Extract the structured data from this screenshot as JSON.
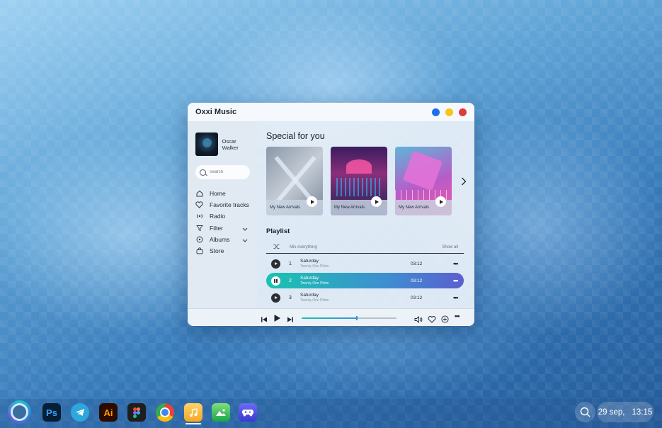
{
  "app": {
    "title": "Oxxi Music",
    "window_dots": [
      "#1f6fe6",
      "#f5c518",
      "#e03b3b"
    ]
  },
  "user": {
    "name": "Oscar Walker"
  },
  "search": {
    "placeholder": "Search",
    "value": ""
  },
  "nav": [
    {
      "label": "Home",
      "icon": "home-icon"
    },
    {
      "label": "Favorite tracks",
      "icon": "heart-icon"
    },
    {
      "label": "Radio",
      "icon": "radio-icon"
    },
    {
      "label": "Filter",
      "icon": "filter-icon",
      "expandable": true
    },
    {
      "label": "Albums",
      "icon": "album-icon",
      "expandable": true
    },
    {
      "label": "Store",
      "icon": "store-icon"
    }
  ],
  "special": {
    "title": "Special for you",
    "cards": [
      {
        "label": "My New Arrivals"
      },
      {
        "label": "My New Arrivals"
      },
      {
        "label": "My New Arrivals"
      }
    ]
  },
  "playlist": {
    "title": "Playlist",
    "mix_label": "Mix everything",
    "show_all": "Show all",
    "tracks": [
      {
        "num": "1",
        "title": "Saturday",
        "artist": "Twenty One Pilots",
        "duration": "03:12",
        "playing": false
      },
      {
        "num": "2",
        "title": "Saturday",
        "artist": "Twenty One Pilots",
        "duration": "03:12",
        "playing": true
      },
      {
        "num": "3",
        "title": "Saturday",
        "artist": "Twenty One Pilots",
        "duration": "03:12",
        "playing": false
      }
    ]
  },
  "player": {
    "progress": 0.58
  },
  "taskbar": {
    "apps": [
      "start-icon",
      "photoshop-icon",
      "telegram-icon",
      "illustrator-icon",
      "figma-icon",
      "chrome-icon",
      "music-icon",
      "gallery-icon",
      "game-icon"
    ],
    "ps_label": "Ps",
    "ai_label": "Ai",
    "date": "29 sep,",
    "time": "13:15"
  },
  "colors": {
    "accent_start": "#19c3b0",
    "accent_end": "#5b5fd0"
  }
}
